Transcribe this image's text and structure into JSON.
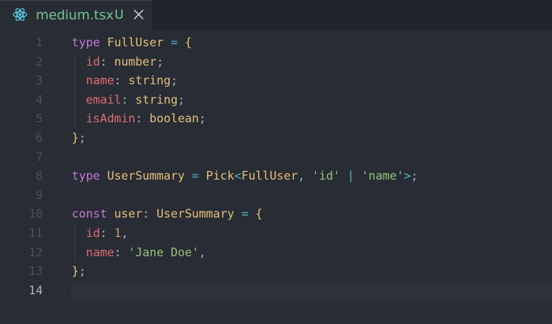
{
  "tab": {
    "filename": "medium.tsx",
    "status": "U",
    "icon": "react-icon",
    "close_icon": "close-icon"
  },
  "editor": {
    "current_line": 14,
    "lines": [
      {
        "n": "1",
        "tokens": [
          {
            "t": "type",
            "c": "kw"
          },
          {
            "t": " ",
            "c": "pu"
          },
          {
            "t": "FullUser",
            "c": "ty"
          },
          {
            "t": " = ",
            "c": "op"
          },
          {
            "t": "{",
            "c": "va"
          }
        ]
      },
      {
        "n": "2",
        "tokens": [
          {
            "t": "  ",
            "c": "pu"
          },
          {
            "t": "id",
            "c": "pr"
          },
          {
            "t": ": ",
            "c": "pu"
          },
          {
            "t": "number",
            "c": "ty"
          },
          {
            "t": ";",
            "c": "pu"
          }
        ]
      },
      {
        "n": "3",
        "tokens": [
          {
            "t": "  ",
            "c": "pu"
          },
          {
            "t": "name",
            "c": "pr"
          },
          {
            "t": ": ",
            "c": "pu"
          },
          {
            "t": "string",
            "c": "ty"
          },
          {
            "t": ";",
            "c": "pu"
          }
        ]
      },
      {
        "n": "4",
        "tokens": [
          {
            "t": "  ",
            "c": "pu"
          },
          {
            "t": "email",
            "c": "pr"
          },
          {
            "t": ": ",
            "c": "pu"
          },
          {
            "t": "string",
            "c": "ty"
          },
          {
            "t": ";",
            "c": "pu"
          }
        ]
      },
      {
        "n": "5",
        "tokens": [
          {
            "t": "  ",
            "c": "pu"
          },
          {
            "t": "isAdmin",
            "c": "pr"
          },
          {
            "t": ": ",
            "c": "pu"
          },
          {
            "t": "boolean",
            "c": "ty"
          },
          {
            "t": ";",
            "c": "pu"
          }
        ]
      },
      {
        "n": "6",
        "tokens": [
          {
            "t": "}",
            "c": "va"
          },
          {
            "t": ";",
            "c": "pu"
          }
        ]
      },
      {
        "n": "7",
        "tokens": []
      },
      {
        "n": "8",
        "tokens": [
          {
            "t": "type",
            "c": "kw"
          },
          {
            "t": " ",
            "c": "pu"
          },
          {
            "t": "UserSummary",
            "c": "ty"
          },
          {
            "t": " = ",
            "c": "op"
          },
          {
            "t": "Pick",
            "c": "ty"
          },
          {
            "t": "<",
            "c": "op"
          },
          {
            "t": "FullUser",
            "c": "ty"
          },
          {
            "t": ", ",
            "c": "pu"
          },
          {
            "t": "'id'",
            "c": "st"
          },
          {
            "t": " | ",
            "c": "op"
          },
          {
            "t": "'name'",
            "c": "st"
          },
          {
            "t": ">",
            "c": "op"
          },
          {
            "t": ";",
            "c": "pu"
          }
        ]
      },
      {
        "n": "9",
        "tokens": []
      },
      {
        "n": "10",
        "tokens": [
          {
            "t": "const",
            "c": "kw"
          },
          {
            "t": " ",
            "c": "pu"
          },
          {
            "t": "user",
            "c": "va"
          },
          {
            "t": ": ",
            "c": "pu"
          },
          {
            "t": "UserSummary",
            "c": "ty"
          },
          {
            "t": " = ",
            "c": "op"
          },
          {
            "t": "{",
            "c": "va"
          }
        ]
      },
      {
        "n": "11",
        "tokens": [
          {
            "t": "  ",
            "c": "pu"
          },
          {
            "t": "id",
            "c": "pr"
          },
          {
            "t": ": ",
            "c": "pu"
          },
          {
            "t": "1",
            "c": "nu"
          },
          {
            "t": ",",
            "c": "pu"
          }
        ]
      },
      {
        "n": "12",
        "tokens": [
          {
            "t": "  ",
            "c": "pu"
          },
          {
            "t": "name",
            "c": "pr"
          },
          {
            "t": ": ",
            "c": "pu"
          },
          {
            "t": "'Jane Doe'",
            "c": "st"
          },
          {
            "t": ",",
            "c": "pu"
          }
        ]
      },
      {
        "n": "13",
        "tokens": [
          {
            "t": "}",
            "c": "va"
          },
          {
            "t": ";",
            "c": "pu"
          }
        ]
      },
      {
        "n": "14",
        "tokens": []
      }
    ]
  },
  "colors": {
    "keyword": "#c678dd",
    "type": "#e5c07b",
    "property": "#e06c75",
    "string": "#98c379",
    "number": "#d19a66",
    "operator": "#56b6c2",
    "tab_modified": "#73c991",
    "react_icon": "#61dafb"
  }
}
